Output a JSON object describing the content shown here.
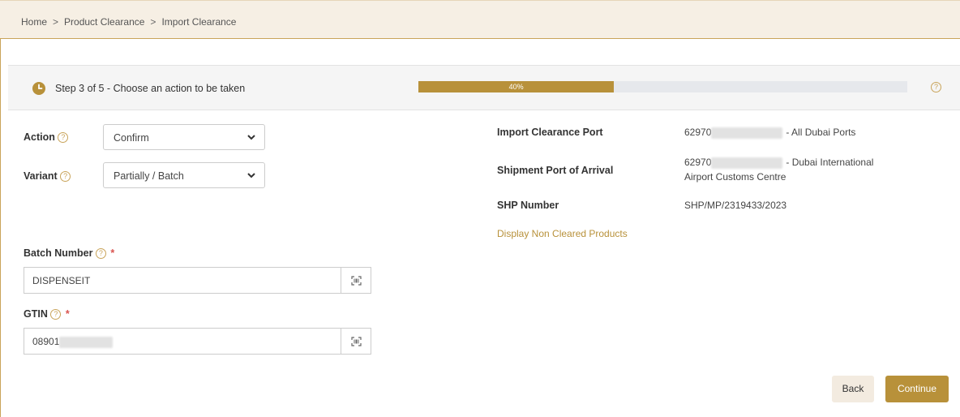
{
  "breadcrumb": [
    "Home",
    "Product Clearance",
    "Import Clearance"
  ],
  "breadcrumb_sep": ">",
  "step": {
    "text": "Step 3 of 5 - Choose an action to be taken",
    "progress_label": "40%",
    "progress": 0.4
  },
  "form": {
    "action_label": "Action",
    "action_value": "Confirm",
    "variant_label": "Variant",
    "variant_value": "Partially / Batch",
    "batch_label": "Batch Number",
    "batch_value": "DISPENSEIT",
    "gtin_label": "GTIN",
    "gtin_value": "08901",
    "help_glyph": "?",
    "required_mark": "*"
  },
  "info": {
    "port_label": "Import Clearance Port",
    "port_code": "62970",
    "port_name": "- All Dubai Ports",
    "arrival_label": "Shipment Port of Arrival",
    "arrival_code": "62970",
    "arrival_name": "- Dubai International",
    "arrival_name_2": "Airport Customs Centre",
    "shp_label": "SHP Number",
    "shp_value": "SHP/MP/2319433/2023",
    "link_text": "Display Non Cleared Products"
  },
  "buttons": {
    "back": "Back",
    "continue": "Continue"
  },
  "colors": {
    "accent": "#b8913a",
    "breadcrumb_bg": "#f6efe4",
    "required": "#d9534f"
  }
}
